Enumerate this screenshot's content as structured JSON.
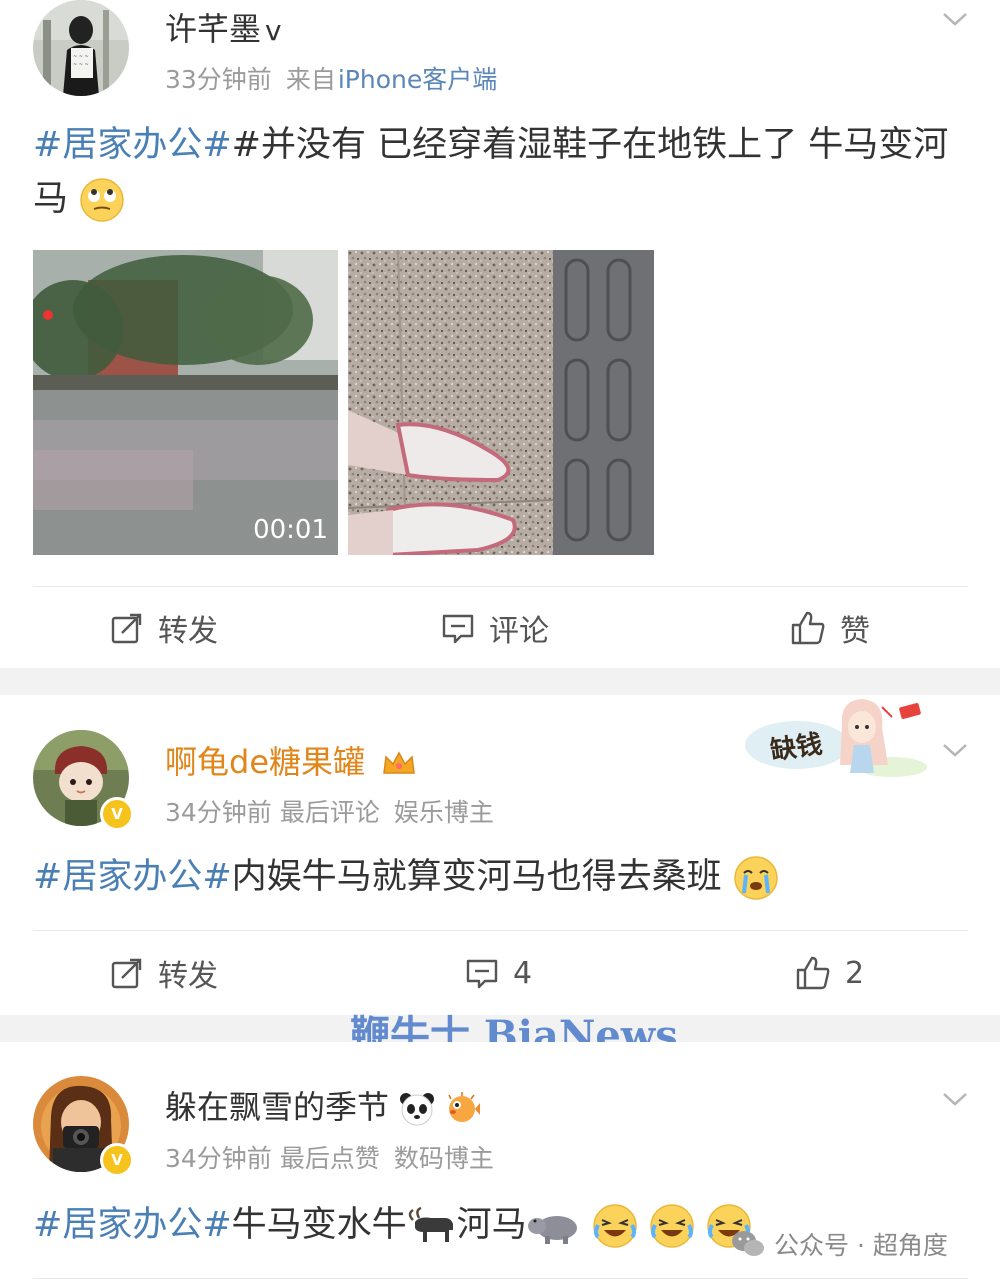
{
  "posts": [
    {
      "username": "许芊墨",
      "verified_mark": "v",
      "time": "33分钟前",
      "source_prefix": "来自",
      "source_device": "iPhone客户端",
      "hashtag": "#居家办公#",
      "text": "#并没有 已经穿着湿鞋子在地铁上了 牛马变河马",
      "media": [
        {
          "kind": "video",
          "duration": "00:01"
        },
        {
          "kind": "image"
        }
      ],
      "actions": {
        "repost": "转发",
        "comment": "评论",
        "like": "赞"
      }
    },
    {
      "username": "啊龟de糖果罐",
      "time": "34分钟前",
      "activity": "最后评论",
      "category": "娱乐博主",
      "hashtag": "#居家办公#",
      "text": "内娱牛马就算变河马也得去桑班",
      "sticker_text": "缺钱",
      "actions": {
        "repost": "转发",
        "comment": "4",
        "like": "2"
      }
    },
    {
      "username": "躲在飘雪的季节",
      "time": "34分钟前",
      "activity": "最后点赞",
      "category": "数码博主",
      "hashtag": "#居家办公#",
      "text_a": "牛马变水牛",
      "text_b": "河马"
    }
  ],
  "watermark": "鞭牛士 BiaNews",
  "footer_mark": "公众号 · 超角度",
  "colors": {
    "hashtag": "#4a7fb5",
    "meta": "#9b9b9b",
    "gold_name": "#e0861a",
    "badge": "#f6c21c"
  }
}
